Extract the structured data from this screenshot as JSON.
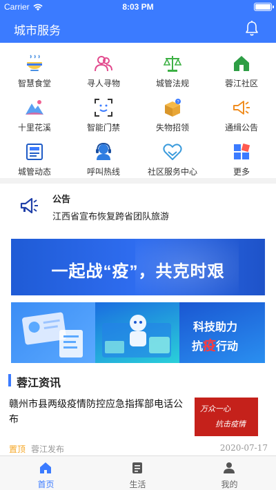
{
  "status_bar": {
    "carrier": "Carrier",
    "time": "8:03 PM"
  },
  "header": {
    "title": "城市服务"
  },
  "services": [
    {
      "label": "智慧食堂",
      "icon": "bowl-icon"
    },
    {
      "label": "寻人寻物",
      "icon": "people-icon"
    },
    {
      "label": "城管法规",
      "icon": "scales-icon"
    },
    {
      "label": "蓉江社区",
      "icon": "home-icon"
    },
    {
      "label": "十里花溪",
      "icon": "mountain-icon"
    },
    {
      "label": "智能门禁",
      "icon": "face-scan-icon"
    },
    {
      "label": "失物招领",
      "icon": "box-icon"
    },
    {
      "label": "通缉公告",
      "icon": "megaphone-icon"
    },
    {
      "label": "城管动态",
      "icon": "newspaper-icon"
    },
    {
      "label": "呼叫热线",
      "icon": "headset-icon"
    },
    {
      "label": "社区服务中心",
      "icon": "heart-hands-icon"
    },
    {
      "label": "更多",
      "icon": "grid-icon"
    }
  ],
  "notice": {
    "title": "公告",
    "text": "江西省宣布恢复跨省团队旅游"
  },
  "banners": {
    "top_text": "一起战“疫”，共克时艰",
    "bottom_line1": "科技助力",
    "bottom_line2_a": "抗",
    "bottom_line2_b": "疫",
    "bottom_line2_c": "行动"
  },
  "news": {
    "section_title": "蓉江资讯",
    "items": [
      {
        "headline": "赣州市县两级疫情防控应急指挥部电话公布",
        "pin": "置顶",
        "source": "蓉江发布",
        "date": "2020-07-17",
        "thumb_line1": "万众一心",
        "thumb_line2": "抗击疫情"
      }
    ]
  },
  "tabs": [
    {
      "label": "首页",
      "active": true
    },
    {
      "label": "生活",
      "active": false
    },
    {
      "label": "我的",
      "active": false
    }
  ],
  "colors": {
    "accent": "#3b7bff",
    "pin": "#f5a623"
  }
}
